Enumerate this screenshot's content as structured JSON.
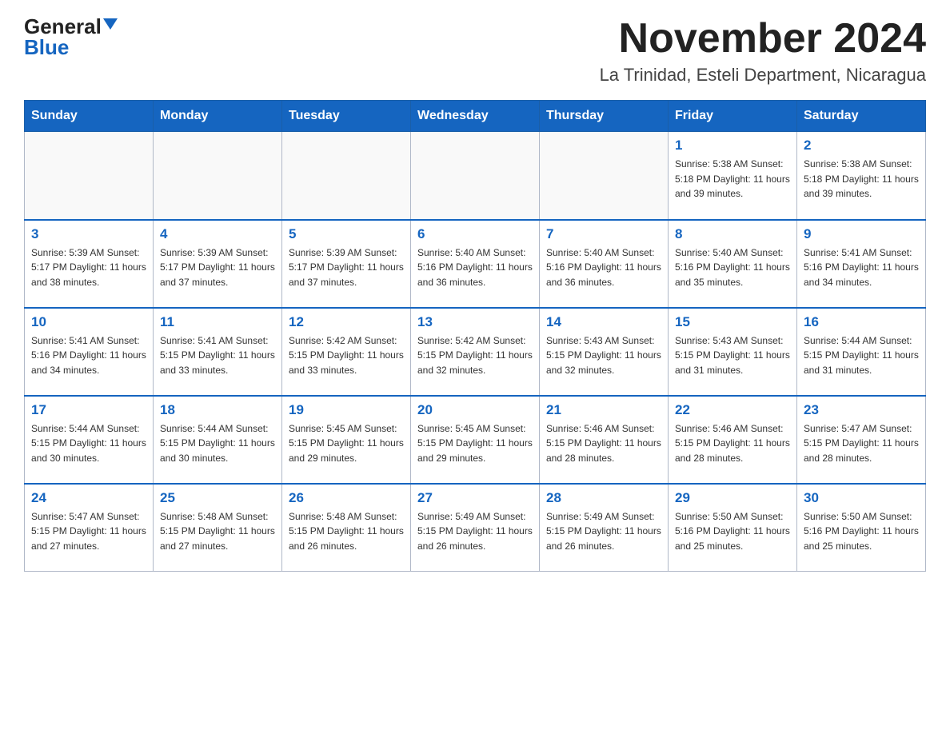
{
  "logo": {
    "general": "General",
    "blue": "Blue"
  },
  "title": "November 2024",
  "subtitle": "La Trinidad, Esteli Department, Nicaragua",
  "headers": [
    "Sunday",
    "Monday",
    "Tuesday",
    "Wednesday",
    "Thursday",
    "Friday",
    "Saturday"
  ],
  "weeks": [
    [
      {
        "day": "",
        "info": ""
      },
      {
        "day": "",
        "info": ""
      },
      {
        "day": "",
        "info": ""
      },
      {
        "day": "",
        "info": ""
      },
      {
        "day": "",
        "info": ""
      },
      {
        "day": "1",
        "info": "Sunrise: 5:38 AM\nSunset: 5:18 PM\nDaylight: 11 hours\nand 39 minutes."
      },
      {
        "day": "2",
        "info": "Sunrise: 5:38 AM\nSunset: 5:18 PM\nDaylight: 11 hours\nand 39 minutes."
      }
    ],
    [
      {
        "day": "3",
        "info": "Sunrise: 5:39 AM\nSunset: 5:17 PM\nDaylight: 11 hours\nand 38 minutes."
      },
      {
        "day": "4",
        "info": "Sunrise: 5:39 AM\nSunset: 5:17 PM\nDaylight: 11 hours\nand 37 minutes."
      },
      {
        "day": "5",
        "info": "Sunrise: 5:39 AM\nSunset: 5:17 PM\nDaylight: 11 hours\nand 37 minutes."
      },
      {
        "day": "6",
        "info": "Sunrise: 5:40 AM\nSunset: 5:16 PM\nDaylight: 11 hours\nand 36 minutes."
      },
      {
        "day": "7",
        "info": "Sunrise: 5:40 AM\nSunset: 5:16 PM\nDaylight: 11 hours\nand 36 minutes."
      },
      {
        "day": "8",
        "info": "Sunrise: 5:40 AM\nSunset: 5:16 PM\nDaylight: 11 hours\nand 35 minutes."
      },
      {
        "day": "9",
        "info": "Sunrise: 5:41 AM\nSunset: 5:16 PM\nDaylight: 11 hours\nand 34 minutes."
      }
    ],
    [
      {
        "day": "10",
        "info": "Sunrise: 5:41 AM\nSunset: 5:16 PM\nDaylight: 11 hours\nand 34 minutes."
      },
      {
        "day": "11",
        "info": "Sunrise: 5:41 AM\nSunset: 5:15 PM\nDaylight: 11 hours\nand 33 minutes."
      },
      {
        "day": "12",
        "info": "Sunrise: 5:42 AM\nSunset: 5:15 PM\nDaylight: 11 hours\nand 33 minutes."
      },
      {
        "day": "13",
        "info": "Sunrise: 5:42 AM\nSunset: 5:15 PM\nDaylight: 11 hours\nand 32 minutes."
      },
      {
        "day": "14",
        "info": "Sunrise: 5:43 AM\nSunset: 5:15 PM\nDaylight: 11 hours\nand 32 minutes."
      },
      {
        "day": "15",
        "info": "Sunrise: 5:43 AM\nSunset: 5:15 PM\nDaylight: 11 hours\nand 31 minutes."
      },
      {
        "day": "16",
        "info": "Sunrise: 5:44 AM\nSunset: 5:15 PM\nDaylight: 11 hours\nand 31 minutes."
      }
    ],
    [
      {
        "day": "17",
        "info": "Sunrise: 5:44 AM\nSunset: 5:15 PM\nDaylight: 11 hours\nand 30 minutes."
      },
      {
        "day": "18",
        "info": "Sunrise: 5:44 AM\nSunset: 5:15 PM\nDaylight: 11 hours\nand 30 minutes."
      },
      {
        "day": "19",
        "info": "Sunrise: 5:45 AM\nSunset: 5:15 PM\nDaylight: 11 hours\nand 29 minutes."
      },
      {
        "day": "20",
        "info": "Sunrise: 5:45 AM\nSunset: 5:15 PM\nDaylight: 11 hours\nand 29 minutes."
      },
      {
        "day": "21",
        "info": "Sunrise: 5:46 AM\nSunset: 5:15 PM\nDaylight: 11 hours\nand 28 minutes."
      },
      {
        "day": "22",
        "info": "Sunrise: 5:46 AM\nSunset: 5:15 PM\nDaylight: 11 hours\nand 28 minutes."
      },
      {
        "day": "23",
        "info": "Sunrise: 5:47 AM\nSunset: 5:15 PM\nDaylight: 11 hours\nand 28 minutes."
      }
    ],
    [
      {
        "day": "24",
        "info": "Sunrise: 5:47 AM\nSunset: 5:15 PM\nDaylight: 11 hours\nand 27 minutes."
      },
      {
        "day": "25",
        "info": "Sunrise: 5:48 AM\nSunset: 5:15 PM\nDaylight: 11 hours\nand 27 minutes."
      },
      {
        "day": "26",
        "info": "Sunrise: 5:48 AM\nSunset: 5:15 PM\nDaylight: 11 hours\nand 26 minutes."
      },
      {
        "day": "27",
        "info": "Sunrise: 5:49 AM\nSunset: 5:15 PM\nDaylight: 11 hours\nand 26 minutes."
      },
      {
        "day": "28",
        "info": "Sunrise: 5:49 AM\nSunset: 5:15 PM\nDaylight: 11 hours\nand 26 minutes."
      },
      {
        "day": "29",
        "info": "Sunrise: 5:50 AM\nSunset: 5:16 PM\nDaylight: 11 hours\nand 25 minutes."
      },
      {
        "day": "30",
        "info": "Sunrise: 5:50 AM\nSunset: 5:16 PM\nDaylight: 11 hours\nand 25 minutes."
      }
    ]
  ]
}
